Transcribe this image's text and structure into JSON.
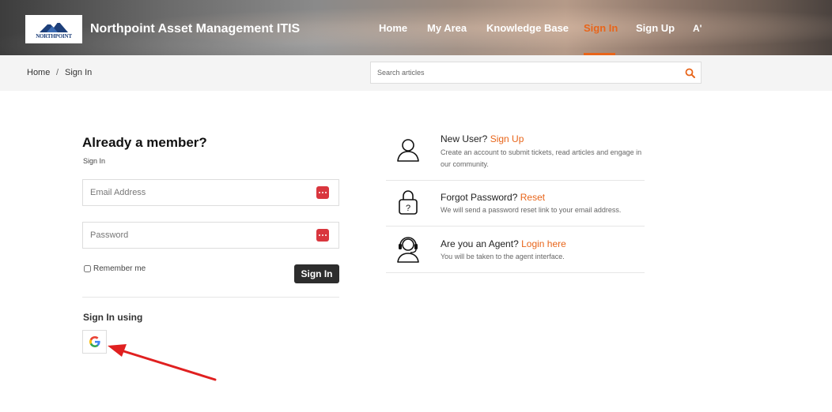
{
  "header": {
    "logo_text": "NORTHPOINT",
    "site_title": "Northpoint Asset Management ITIS",
    "nav": [
      {
        "label": "Home",
        "active": false
      },
      {
        "label": "My Area",
        "active": false
      },
      {
        "label": "Knowledge Base",
        "active": false
      },
      {
        "label": "Sign In",
        "active": true
      },
      {
        "label": "Sign Up",
        "active": false
      },
      {
        "label": "A'",
        "active": false
      }
    ],
    "accent_color": "#e8651a"
  },
  "breadcrumb": {
    "items": [
      "Home",
      "Sign In"
    ],
    "separator": "/"
  },
  "search": {
    "placeholder": "Search articles",
    "icon": "search-icon"
  },
  "login": {
    "title": "Already a member?",
    "subtitle": "Sign In",
    "email_placeholder": "Email Address",
    "password_placeholder": "Password",
    "remember_label": "Remember me",
    "remember_checked": false,
    "submit_label": "Sign In",
    "sign_in_using": "Sign In using",
    "providers": [
      {
        "name": "google-icon"
      }
    ]
  },
  "info": [
    {
      "icon": "user-icon",
      "title": "New User?",
      "link": "Sign Up",
      "desc": "Create an account to submit tickets, read articles and engage in our community."
    },
    {
      "icon": "lock-question-icon",
      "title": "Forgot Password?",
      "link": "Reset",
      "desc": "We will send a password reset link to your email address."
    },
    {
      "icon": "agent-headset-icon",
      "title": "Are you an Agent?",
      "link": "Login here",
      "desc": "You will be taken to the agent interface."
    }
  ],
  "annotation": {
    "arrow_color": "#e02020"
  }
}
